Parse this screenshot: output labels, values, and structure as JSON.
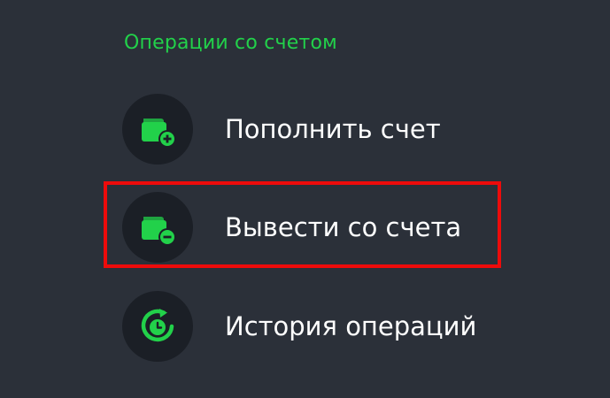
{
  "section": {
    "title": "Операции со счетом"
  },
  "items": [
    {
      "label": "Пополнить счет",
      "icon": "wallet-plus-icon"
    },
    {
      "label": "Вывести со счета",
      "icon": "wallet-minus-icon",
      "highlighted": true
    },
    {
      "label": "История операций",
      "icon": "history-clock-icon"
    }
  ],
  "colors": {
    "background": "#2b3039",
    "icon_circle": "#1b1f26",
    "accent_green": "#22d14a",
    "label_text": "#ffffff",
    "highlight_border": "#ee0b0b"
  }
}
